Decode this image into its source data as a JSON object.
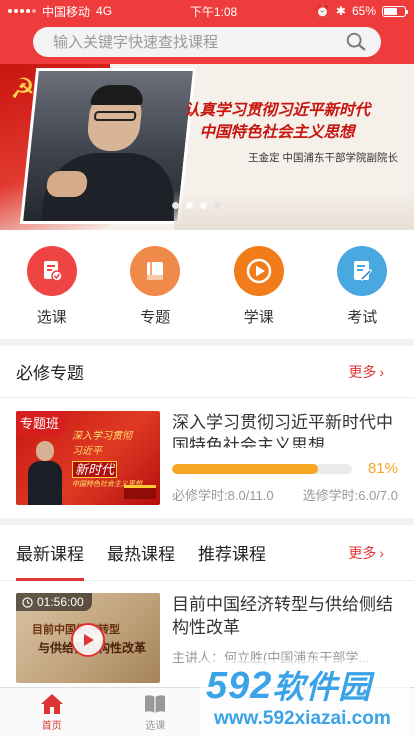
{
  "status_bar": {
    "carrier": "中国移动",
    "network": "4G",
    "time": "下午1:08",
    "battery": "65%"
  },
  "search": {
    "placeholder": "输入关键字快速查找课程"
  },
  "banner": {
    "slogan_line1": "认真学习贯彻习近平新时代",
    "slogan_line2": "中国特色社会主义思想",
    "caption": "王金定  中国浦东干部学院副院长",
    "dots": 4,
    "active_dot": 4
  },
  "quick_entries": [
    {
      "label": "选课",
      "icon": "select-course-icon",
      "color": "#ef4444"
    },
    {
      "label": "专题",
      "icon": "book-icon",
      "color": "#f08a4b"
    },
    {
      "label": "学课",
      "icon": "play-icon",
      "color": "#f27b1a"
    },
    {
      "label": "考试",
      "icon": "exam-icon",
      "color": "#4aa8e0"
    }
  ],
  "required_section": {
    "title": "必修专题",
    "more": "更多",
    "card": {
      "tag": "专题班",
      "thumb_text1": "深入学习贯彻",
      "thumb_text2": "习近平",
      "thumb_text3": "新时代",
      "thumb_text4": "中国特色社会主义思想",
      "title": "深入学习贯彻习近平新时代中国特色社会主义思想",
      "progress": 0.81,
      "progress_label": "81%",
      "required_hours": "必修学时:8.0/11.0",
      "elective_hours": "选修学时:6.0/7.0"
    }
  },
  "course_tabs": {
    "tabs": [
      "最新课程",
      "最热课程",
      "推荐课程"
    ],
    "active": 0,
    "more": "更多"
  },
  "course": {
    "duration": "01:56:00",
    "thumb_text1": "目前中国经济转型",
    "thumb_text2": "与供给侧结构性改革",
    "title": "目前中国经济转型与供给侧结构性改革",
    "meta": "主讲人：何立胜(中国浦东干部学..."
  },
  "tabbar": [
    {
      "label": "首页",
      "icon": "home-icon",
      "active": true
    },
    {
      "label": "选课",
      "icon": "book-open-icon",
      "active": false
    },
    {
      "label": "",
      "icon": "",
      "active": false
    },
    {
      "label": "",
      "icon": "",
      "active": false
    }
  ],
  "watermark": {
    "logo": "592",
    "logo_cn": "软件园",
    "url": "www.592xiazai.com"
  },
  "colors": {
    "primary": "#ee3b3b",
    "progress": "#f5a623",
    "link": "#e03434"
  }
}
